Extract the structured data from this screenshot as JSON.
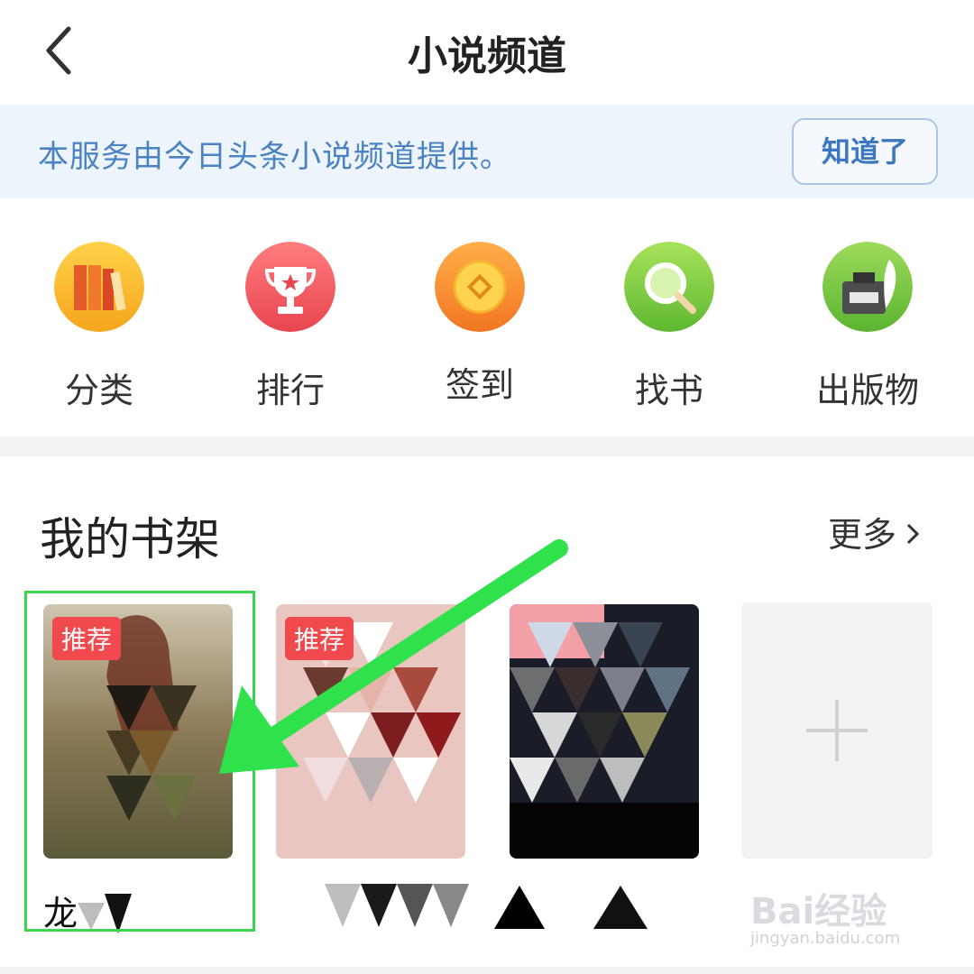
{
  "header": {
    "title": "小说频道",
    "back_icon": "chevron-left-icon"
  },
  "notice": {
    "text": "本服务由今日头条小说频道提供。",
    "button_label": "知道了",
    "text_color": "#4a83c2",
    "bg_color": "#eef4fb"
  },
  "nav": {
    "items": [
      {
        "label": "分类",
        "icon": "books-icon"
      },
      {
        "label": "排行",
        "icon": "trophy-icon"
      },
      {
        "label": "签到",
        "icon": "coin-icon"
      },
      {
        "label": "找书",
        "icon": "magnifier-icon"
      },
      {
        "label": "出版物",
        "icon": "ink-bottle-icon"
      }
    ]
  },
  "shelf": {
    "title": "我的书架",
    "more_label": "更多",
    "books": [
      {
        "badge": "推荐",
        "name": "龙"
      },
      {
        "badge": "推荐",
        "name": ""
      },
      {
        "badge": "",
        "name": ""
      }
    ],
    "add_icon": "plus-icon"
  },
  "watermark": {
    "text": "Bai经验",
    "url": "jingyan.baidu.com"
  },
  "colors": {
    "badge": "#f04a4f",
    "highlight": "#38d64e",
    "arrow": "#2fe14a"
  }
}
